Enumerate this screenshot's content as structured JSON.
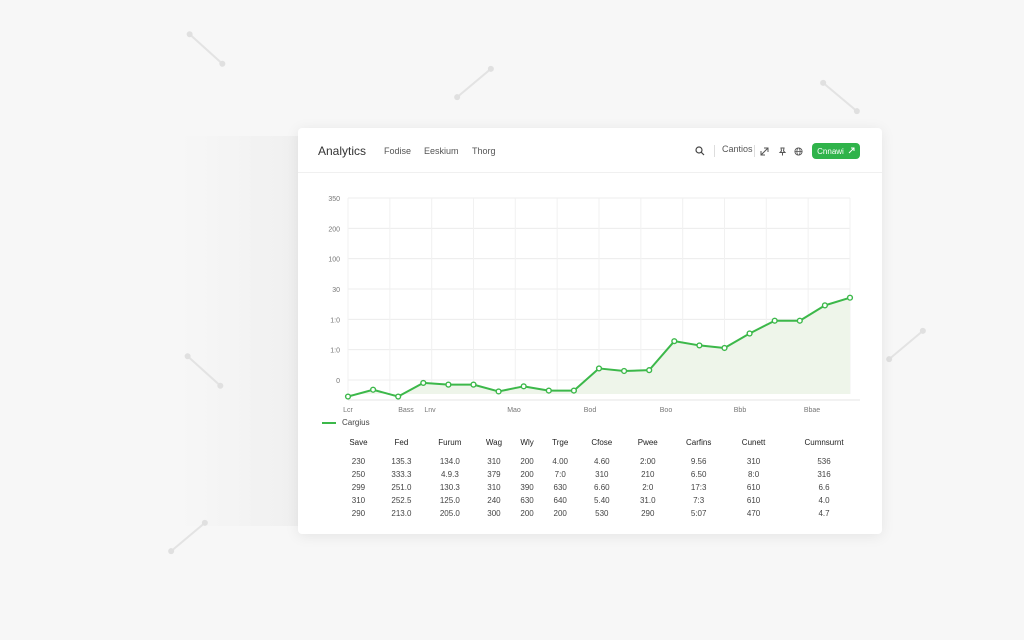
{
  "app": {
    "title": "Analytics",
    "nav": [
      "Fodise",
      "Eeskium",
      "Thorg"
    ]
  },
  "toolbar": {
    "item_label": "Cantios",
    "primary_button_label": "Cnnawi",
    "accent_color": "#2fb34a"
  },
  "icons": {
    "search": "search-icon",
    "expand": "expand-icon",
    "pin": "pin-icon",
    "globe": "globe-icon",
    "button": "chevron-icon"
  },
  "chart_data": {
    "type": "line",
    "y_tick_labels": [
      "0",
      "1:0",
      "1:0",
      "30",
      "100",
      "200",
      "350"
    ],
    "x_tick_labels": [
      "Lcr",
      "Bass",
      "Lnv",
      "Mao",
      "Bod",
      "Boo",
      "Bbb",
      "Bbae"
    ],
    "ylim": [
      0,
      230
    ],
    "grid": true,
    "series": [
      {
        "name": "Cargius",
        "color": "#3cb84a",
        "values": [
          -3,
          5,
          -3,
          13,
          11,
          11,
          3,
          9,
          4,
          4,
          30,
          27,
          28,
          62,
          57,
          54,
          71,
          86,
          86,
          104,
          113
        ]
      }
    ]
  },
  "legend": {
    "label": "Cargius"
  },
  "table": {
    "headers": [
      "Save",
      "Fed",
      "Furum",
      "Wag",
      "Wly",
      "Trge",
      "Cfose",
      "Pwee",
      "Carfins",
      "Cunett",
      "Cumnsurnt"
    ],
    "rows": [
      [
        "230",
        "135.3",
        "134.0",
        "310",
        "200",
        "4.00",
        "4.60",
        "2:00",
        "9.56",
        "310",
        "536"
      ],
      [
        "250",
        "333.3",
        "4.9.3",
        "379",
        "200",
        "7:0",
        "310",
        "210",
        "6.50",
        "8:0",
        "316"
      ],
      [
        "299",
        "251.0",
        "130.3",
        "310",
        "390",
        "630",
        "6.60",
        "2:0",
        "17:3",
        "610",
        "6.6"
      ],
      [
        "310",
        "252.5",
        "125.0",
        "240",
        "630",
        "640",
        "5.40",
        "31.0",
        "7:3",
        "610",
        "4.0"
      ],
      [
        "290",
        "213.0",
        "205.0",
        "300",
        "200",
        "200",
        "530",
        "290",
        "5:07",
        "470",
        "4.7"
      ]
    ]
  }
}
